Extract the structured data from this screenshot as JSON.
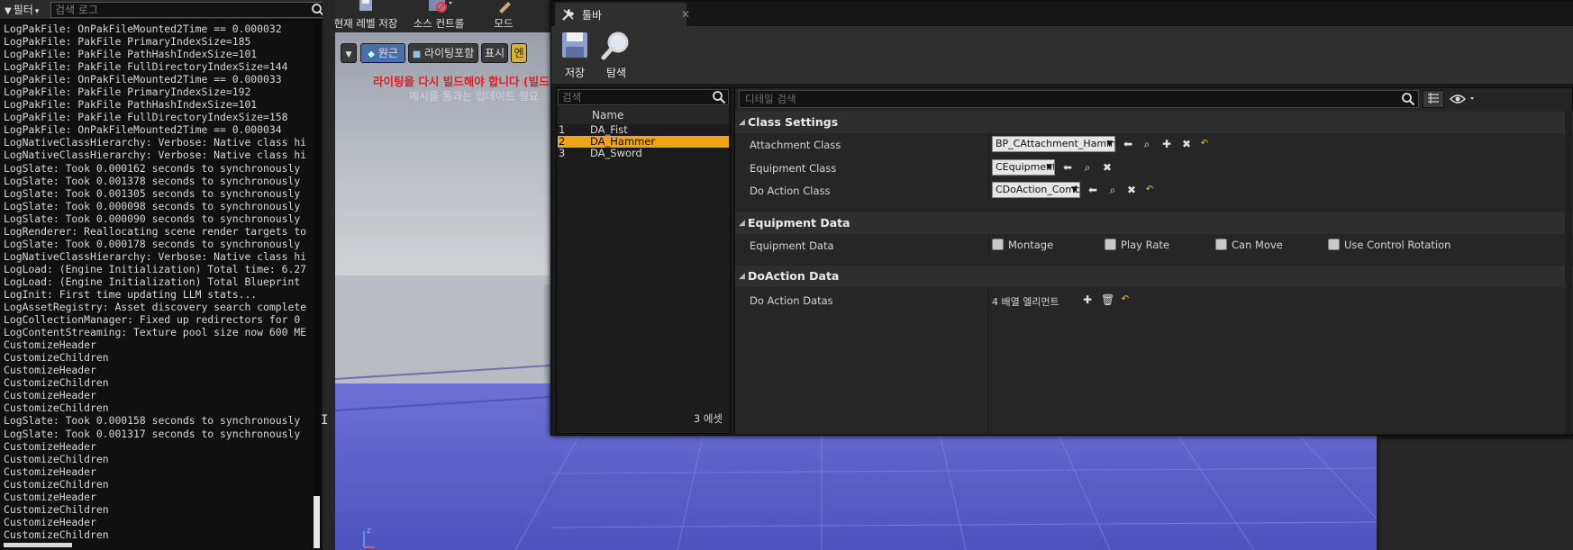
{
  "log": {
    "filter_label": "필터",
    "search_placeholder": "검색 로그",
    "lines": [
      "LogPakFile: OnPakFileMounted2Time == 0.000032",
      "LogPakFile: PakFile PrimaryIndexSize=185",
      "LogPakFile: PakFile PathHashIndexSize=101",
      "LogPakFile: PakFile FullDirectoryIndexSize=144",
      "LogPakFile: OnPakFileMounted2Time == 0.000033",
      "LogPakFile: PakFile PrimaryIndexSize=192",
      "LogPakFile: PakFile PathHashIndexSize=101",
      "LogPakFile: PakFile FullDirectoryIndexSize=158",
      "LogPakFile: OnPakFileMounted2Time == 0.000034",
      "LogNativeClassHierarchy: Verbose: Native class hi",
      "LogNativeClassHierarchy: Verbose: Native class hi",
      "LogSlate: Took 0.000162 seconds to synchronously",
      "LogSlate: Took 0.001378 seconds to synchronously",
      "LogSlate: Took 0.001305 seconds to synchronously",
      "LogSlate: Took 0.000098 seconds to synchronously",
      "LogSlate: Took 0.000090 seconds to synchronously",
      "LogRenderer: Reallocating scene render targets to",
      "LogSlate: Took 0.000178 seconds to synchronously",
      "LogNativeClassHierarchy: Verbose: Native class hi",
      "LogLoad: (Engine Initialization) Total time: 6.27",
      "LogLoad: (Engine Initialization) Total Blueprint",
      "LogInit: First time updating LLM stats...",
      "LogAssetRegistry: Asset discovery search complete",
      "LogCollectionManager: Fixed up redirectors for 0",
      "LogContentStreaming: Texture pool size now 600 ME",
      "CustomizeHeader",
      "CustomizeChildren",
      "CustomizeHeader",
      "CustomizeChildren",
      "CustomizeHeader",
      "CustomizeChildren",
      "LogSlate: Took 0.000158 seconds to synchronously",
      "LogSlate: Took 0.001317 seconds to synchronously",
      "CustomizeHeader",
      "CustomizeChildren",
      "CustomizeHeader",
      "CustomizeChildren",
      "CustomizeHeader",
      "CustomizeChildren",
      "CustomizeHeader",
      "CustomizeChildren"
    ]
  },
  "main_toolbar": {
    "save_level_label": "현재 레벨 저장",
    "source_control_label": "소스 컨트롤",
    "modes_label": "모드"
  },
  "viewport": {
    "perspective_label": "원근",
    "lighting_label": "라이팅포함",
    "show_label": "표시",
    "extra_label": "엔",
    "warning_text": "라이팅을 다시 빌드해야 합니다 (빌드",
    "warning_sub": "메시를 통과는 업데이트 필요"
  },
  "tool_window": {
    "tab_label": "툴바",
    "save_label": "저장",
    "browse_label": "탐색",
    "asset_list": {
      "search_placeholder": "검색",
      "column_name": "Name",
      "items": [
        {
          "index": "1",
          "name": "DA_Fist",
          "selected": false
        },
        {
          "index": "2",
          "name": "DA_Hammer",
          "selected": true
        },
        {
          "index": "3",
          "name": "DA_Sword",
          "selected": false
        }
      ],
      "count_label": "3 에셋"
    },
    "details": {
      "search_placeholder": "디테일 검색",
      "class_settings": {
        "title": "Class Settings",
        "attachment_class_label": "Attachment Class",
        "attachment_class_value": "BP_CAttachment_Hammer",
        "equipment_class_label": "Equipment Class",
        "equipment_class_value": "CEquipment",
        "do_action_class_label": "Do Action Class",
        "do_action_class_value": "CDoAction_Combo"
      },
      "equipment_data": {
        "title": "Equipment Data",
        "row_label": "Equipment Data",
        "montage_label": "Montage",
        "play_rate_label": "Play Rate",
        "can_move_label": "Can Move",
        "use_control_rotation_label": "Use Control Rotation"
      },
      "doaction_data": {
        "title": "DoAction Data",
        "row_label": "Do Action Datas",
        "array_count": "4 배열 엘리먼트"
      }
    }
  },
  "colors": {
    "selection": "#f0a418",
    "panel_bg": "#242424",
    "warning": "#e02020",
    "ground_blue": "#5a62c9"
  },
  "viewport_axis_label": "z"
}
